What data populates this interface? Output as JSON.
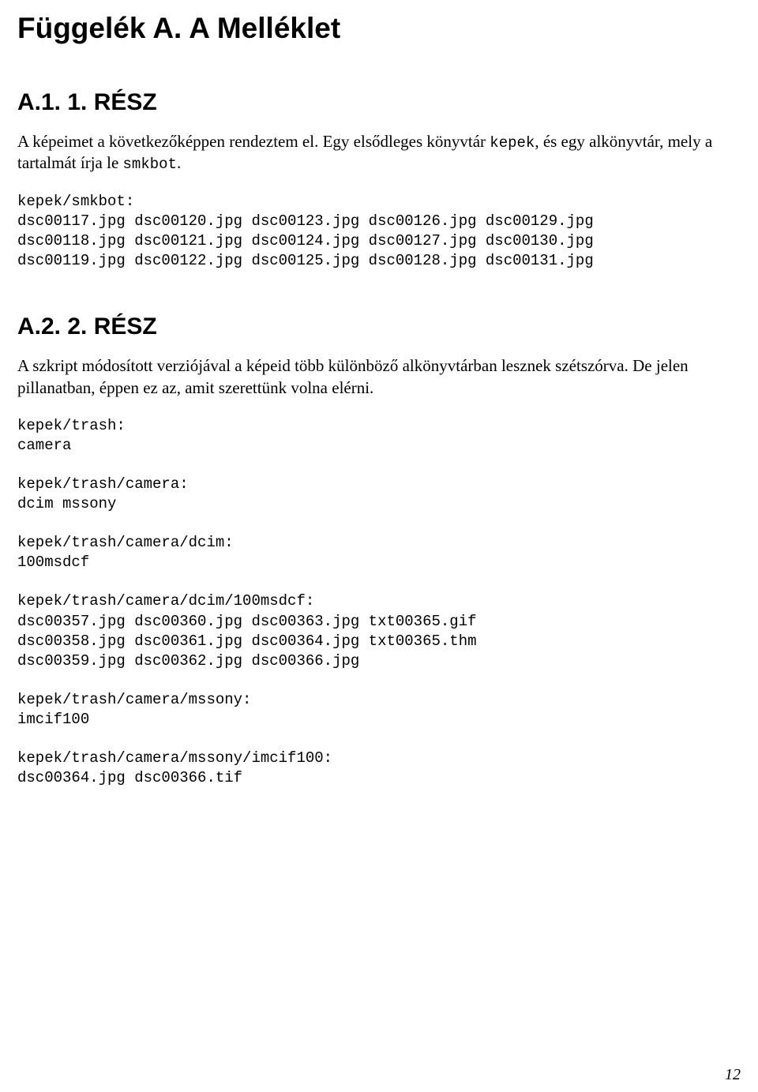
{
  "title": "Függelék A. A Melléklet",
  "section1": {
    "heading": "A.1. 1. RÉSZ",
    "para_pre": "A képeimet a következőképpen rendeztem el. Egy elsődleges könyvtár ",
    "mono1": "kepek",
    "para_mid": ", és egy alkönyvtár, mely a tartalmát írja le ",
    "mono2": "smkbot",
    "para_post": ".",
    "listing": "kepek/smkbot:\ndsc00117.jpg dsc00120.jpg dsc00123.jpg dsc00126.jpg dsc00129.jpg\ndsc00118.jpg dsc00121.jpg dsc00124.jpg dsc00127.jpg dsc00130.jpg\ndsc00119.jpg dsc00122.jpg dsc00125.jpg dsc00128.jpg dsc00131.jpg"
  },
  "section2": {
    "heading": "A.2. 2. RÉSZ",
    "para": "A szkript módosított verziójával a képeid több különböző alkönyvtárban lesznek szétszórva. De jelen pillanatban, éppen ez az, amit szerettünk volna elérni.",
    "listing1": "kepek/trash:\ncamera",
    "listing2": "kepek/trash/camera:\ndcim mssony",
    "listing3": "kepek/trash/camera/dcim:\n100msdcf",
    "listing4": "kepek/trash/camera/dcim/100msdcf:\ndsc00357.jpg dsc00360.jpg dsc00363.jpg txt00365.gif\ndsc00358.jpg dsc00361.jpg dsc00364.jpg txt00365.thm\ndsc00359.jpg dsc00362.jpg dsc00366.jpg",
    "listing5": "kepek/trash/camera/mssony:\nimcif100",
    "listing6": "kepek/trash/camera/mssony/imcif100:\ndsc00364.jpg dsc00366.tif"
  },
  "page_number": "12"
}
